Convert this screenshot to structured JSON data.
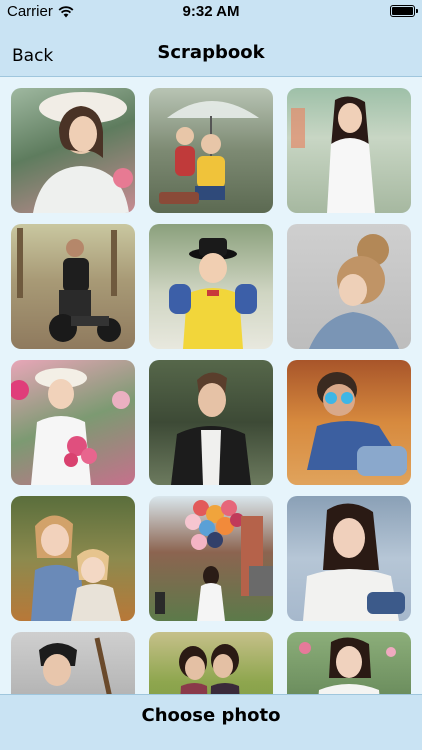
{
  "status_bar": {
    "carrier": "Carrier",
    "time": "9:32 AM",
    "wifi_icon": "wifi-icon",
    "battery_icon": "battery-icon"
  },
  "nav": {
    "back_label": "Back",
    "title": "Scrapbook"
  },
  "photos": [
    {
      "name": "photo-woman-white-hat"
    },
    {
      "name": "photo-children-umbrella"
    },
    {
      "name": "photo-woman-white-ao-dai"
    },
    {
      "name": "photo-man-motorbike"
    },
    {
      "name": "photo-boy-black-hat"
    },
    {
      "name": "photo-woman-hair-bun"
    },
    {
      "name": "photo-girl-flowers"
    },
    {
      "name": "photo-man-leather-jacket"
    },
    {
      "name": "photo-man-sunglasses"
    },
    {
      "name": "photo-girls-hugging"
    },
    {
      "name": "photo-woman-balloons"
    },
    {
      "name": "photo-woman-white-shirt"
    },
    {
      "name": "photo-man-guitar"
    },
    {
      "name": "photo-couple-field"
    },
    {
      "name": "photo-woman-ao-dai-flowers"
    }
  ],
  "bottom": {
    "choose_label": "Choose photo"
  },
  "colors": {
    "bar_background": "#c9e3f3",
    "page_background": "#e6f4fb"
  }
}
